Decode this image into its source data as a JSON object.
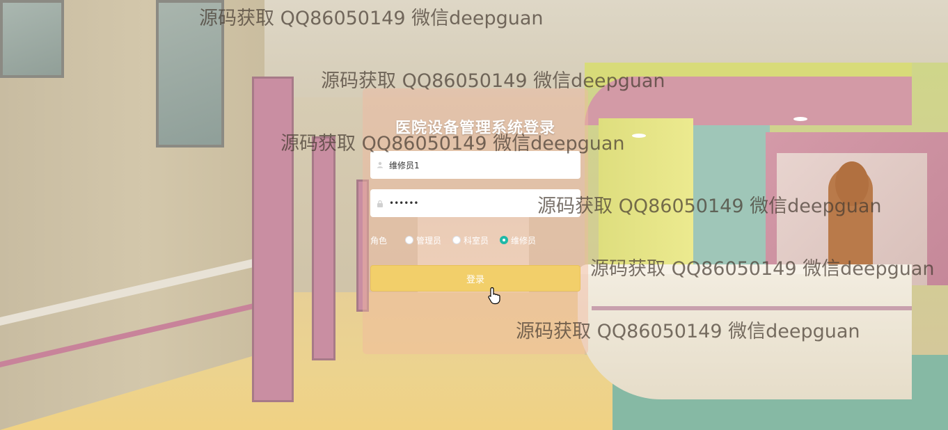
{
  "login": {
    "title": "医院设备管理系统登录",
    "username": {
      "value": "维修员1",
      "icon": "user-icon"
    },
    "password": {
      "value": "••••••",
      "icon": "lock-icon"
    },
    "role": {
      "label": "角色",
      "options": [
        {
          "label": "管理员",
          "checked": false
        },
        {
          "label": "科室员",
          "checked": false
        },
        {
          "label": "维修员",
          "checked": true
        }
      ]
    },
    "submit_label": "登录"
  },
  "watermarks": [
    "源码获取 QQ86050149 微信deepguan",
    "源码获取 QQ86050149 微信deepguan",
    "源码获取 QQ86050149 微信deepguan",
    "源码获取 QQ86050149 微信deepguan",
    "源码获取 QQ86050149 微信deepguan",
    "源码获取 QQ86050149 微信deepguan"
  ],
  "colors": {
    "panel": "#f2b89f",
    "button": "#f2cf6a",
    "radio_checked": "#1fb9a8"
  }
}
